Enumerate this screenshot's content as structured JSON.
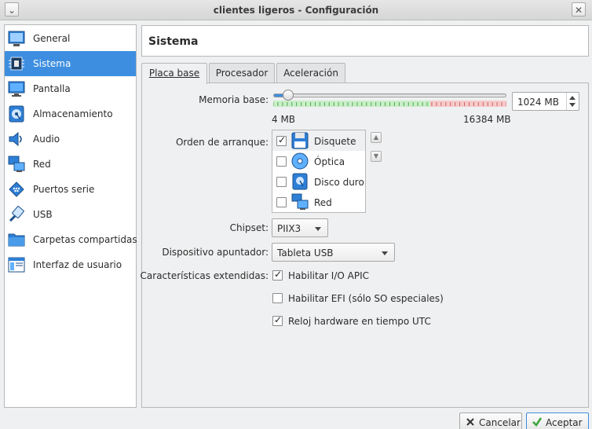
{
  "window": {
    "title": "clientes ligeros - Configuración",
    "close_glyph": "✕",
    "minimize_glyph": "⌄"
  },
  "sidebar": {
    "items": [
      {
        "label": "General",
        "icon": "general-icon"
      },
      {
        "label": "Sistema",
        "icon": "system-chip-icon"
      },
      {
        "label": "Pantalla",
        "icon": "display-icon"
      },
      {
        "label": "Almacenamiento",
        "icon": "storage-disk-icon"
      },
      {
        "label": "Audio",
        "icon": "speaker-icon"
      },
      {
        "label": "Red",
        "icon": "network-icon"
      },
      {
        "label": "Puertos serie",
        "icon": "serial-port-icon"
      },
      {
        "label": "USB",
        "icon": "usb-icon"
      },
      {
        "label": "Carpetas compartidas",
        "icon": "shared-folder-icon"
      },
      {
        "label": "Interfaz de usuario",
        "icon": "user-interface-icon"
      }
    ],
    "selected": "Sistema"
  },
  "header": {
    "title": "Sistema"
  },
  "tabs": [
    {
      "label": "Placa base",
      "active": true
    },
    {
      "label": "Procesador",
      "active": false
    },
    {
      "label": "Aceleración",
      "active": false
    }
  ],
  "memory": {
    "label": "Memoria base:",
    "value_text": "1024 MB",
    "min_label": "4 MB",
    "max_label": "16384 MB",
    "value_mb": 1024,
    "max_mb": 16384
  },
  "boot_order": {
    "label": "Orden de arranque:",
    "items": [
      {
        "label": "Disquete",
        "checked": true,
        "icon": "floppy-icon"
      },
      {
        "label": "Óptica",
        "checked": false,
        "icon": "optical-disc-icon"
      },
      {
        "label": "Disco duro",
        "checked": false,
        "icon": "hard-disk-icon"
      },
      {
        "label": "Red",
        "checked": false,
        "icon": "network-icon"
      }
    ],
    "up_glyph": "▲",
    "down_glyph": "▼"
  },
  "chipset": {
    "label": "Chipset:",
    "value": "PIIX3"
  },
  "pointing": {
    "label": "Dispositivo apuntador:",
    "value": "Tableta USB"
  },
  "extended": {
    "label": "Características extendidas:",
    "items": [
      {
        "label": "Habilitar I/O APIC",
        "checked": true
      },
      {
        "label": "Habilitar EFI (sólo SO especiales)",
        "checked": false
      },
      {
        "label": "Reloj hardware en tiempo UTC",
        "checked": true
      }
    ]
  },
  "buttons": {
    "cancel": "Cancelar",
    "accept": "Aceptar"
  },
  "colors": {
    "accent": "#3d8ee0",
    "scale_green": "#8fd48f",
    "scale_red": "#f0a0a0"
  }
}
